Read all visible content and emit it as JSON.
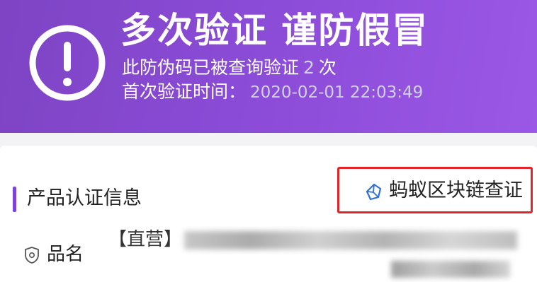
{
  "banner": {
    "title": "多次验证 谨防假冒",
    "query_prefix": "此防伪码已被查询验证",
    "query_count": "2",
    "query_suffix": "次",
    "first_label": "首次验证时间：",
    "first_time": "2020-02-01 22:03:49",
    "icon": "exclamation-circle-icon",
    "colors": {
      "bg_start": "#7e44c4",
      "bg_end": "#9b57e6"
    }
  },
  "section": {
    "title": "产品认证信息",
    "accent": "#7a45d8"
  },
  "chain_link": {
    "label": "蚂蚁区块链查证",
    "icon": "blockchain-icon",
    "highlight_color": "#e0262a"
  },
  "fields": {
    "product_name": {
      "label": "品名",
      "value_prefix": "【直营】",
      "icon": "shield-icon"
    }
  }
}
